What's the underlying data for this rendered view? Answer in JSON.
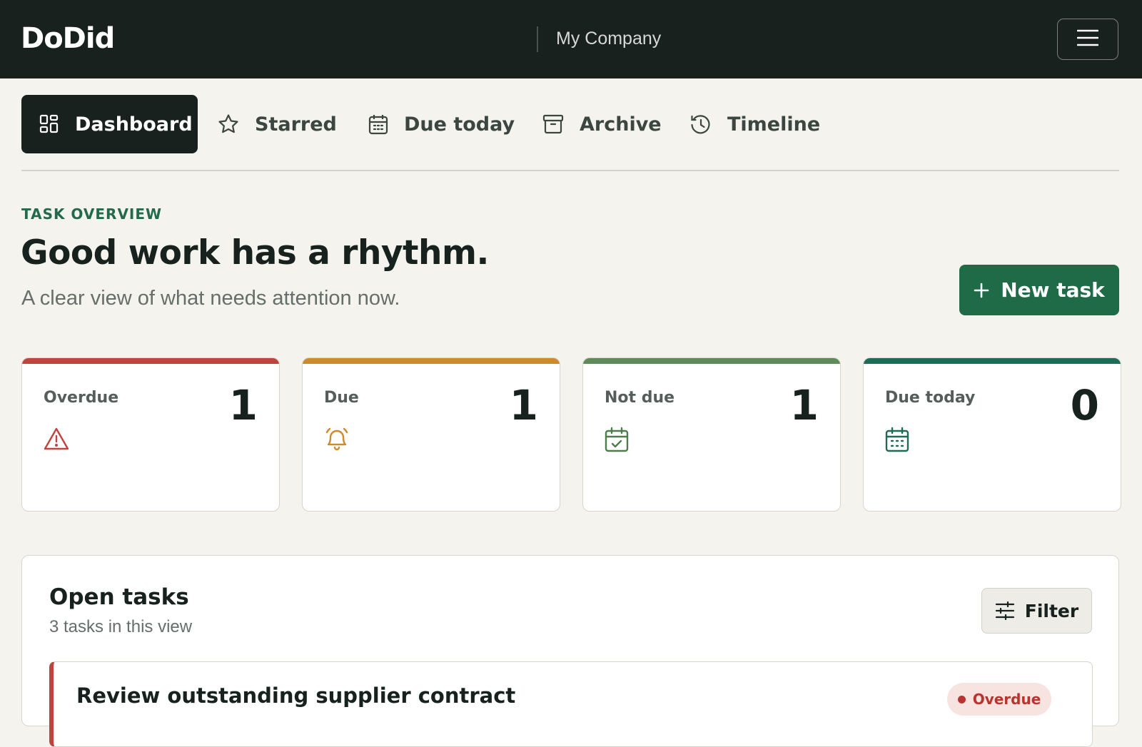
{
  "app": {
    "brand": "DoDid",
    "company": "My Company",
    "menu_icon": "hamburger-icon"
  },
  "tabs": [
    {
      "label": "Dashboard",
      "icon": "grid-icon",
      "active": true
    },
    {
      "label": "Starred",
      "icon": "star-icon",
      "active": false
    },
    {
      "label": "Due today",
      "icon": "calendar-icon",
      "active": false
    },
    {
      "label": "Archive",
      "icon": "archive-icon",
      "active": false
    },
    {
      "label": "Timeline",
      "icon": "history-icon",
      "active": false
    }
  ],
  "overview": {
    "eyebrow": "TASK OVERVIEW",
    "headline": "Good work has a rhythm.",
    "subline": "A clear view of what needs attention now.",
    "new_task_label": "New task"
  },
  "stats": [
    {
      "label": "Overdue",
      "value": "1",
      "icon": "alert-triangle-icon",
      "color": "#c0433d"
    },
    {
      "label": "Due",
      "value": "1",
      "icon": "bell-icon",
      "color": "#cf8a2c"
    },
    {
      "label": "Not due",
      "value": "1",
      "icon": "calendar-check-icon",
      "color": "#5e8c59"
    },
    {
      "label": "Due today",
      "value": "0",
      "icon": "calendar-icon",
      "color": "#1f6b55"
    }
  ],
  "open_tasks": {
    "title": "Open tasks",
    "subtitle": "3 tasks in this view",
    "filter_label": "Filter",
    "tasks": [
      {
        "title": "Review outstanding supplier contract",
        "status": "Overdue"
      }
    ]
  },
  "colors": {
    "accent": "#1f6b48",
    "dark": "#19211f",
    "danger": "#c0433d",
    "background": "#f5f3ee"
  }
}
